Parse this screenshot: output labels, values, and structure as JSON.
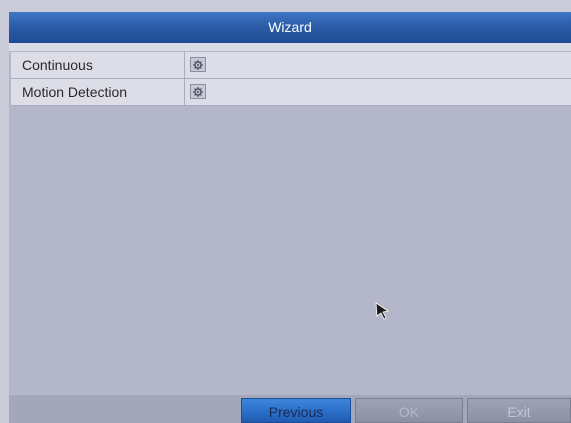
{
  "window": {
    "title": "Wizard"
  },
  "record_types": [
    {
      "label": "Continuous",
      "settings_icon": "gear-icon"
    },
    {
      "label": "Motion Detection",
      "settings_icon": "gear-icon"
    }
  ],
  "footer": {
    "previous_label": "Previous",
    "ok_label": "OK",
    "exit_label": "Exit"
  },
  "colors": {
    "title_bar": "#2c5da8",
    "active_button": "#2b6fc8",
    "panel_background": "#b4b6ca"
  }
}
